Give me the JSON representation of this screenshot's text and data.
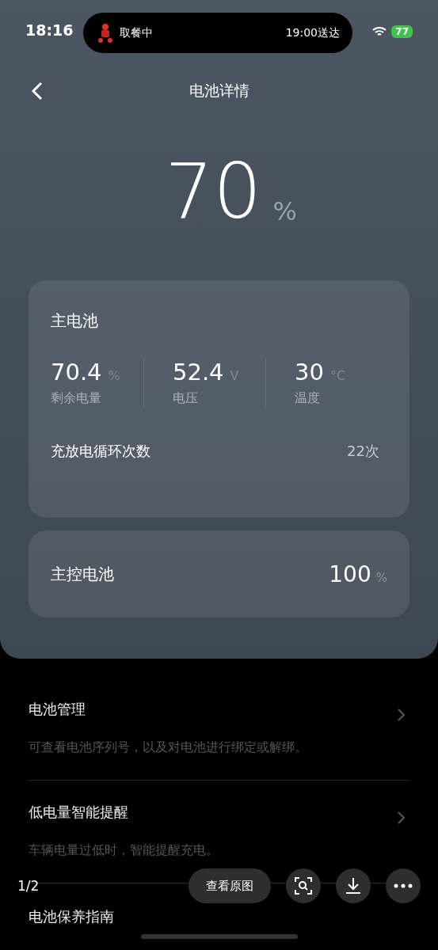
{
  "status_bar": {
    "time": "18:16",
    "live_activity": {
      "status": "取餐中",
      "eta": "19:00送达"
    },
    "battery": "77"
  },
  "header": {
    "title": "电池详情"
  },
  "overall": {
    "value": "70",
    "unit": "%"
  },
  "main_battery": {
    "title": "主电池",
    "stats": [
      {
        "value": "70.4",
        "unit": "%",
        "label": "剩余电量"
      },
      {
        "value": "52.4",
        "unit": "V",
        "label": "电压"
      },
      {
        "value": "30",
        "unit": "°C",
        "label": "温度"
      }
    ],
    "cycles": {
      "label": "充放电循环次数",
      "value": "22次"
    }
  },
  "controller_battery": {
    "label": "主控电池",
    "value": "100",
    "unit": "%"
  },
  "menu": [
    {
      "title": "电池管理",
      "description": "可查看电池序列号，以及对电池进行绑定或解绑。"
    },
    {
      "title": "低电量智能提醒",
      "description": "车辆电量过低时，智能提醒充电。"
    },
    {
      "title": "电池保养指南"
    }
  ],
  "viewer": {
    "page": "1/2",
    "buttons": [
      {
        "kind": "text",
        "label": "查看原图"
      },
      {
        "kind": "scan"
      },
      {
        "kind": "download"
      },
      {
        "kind": "more"
      }
    ]
  }
}
